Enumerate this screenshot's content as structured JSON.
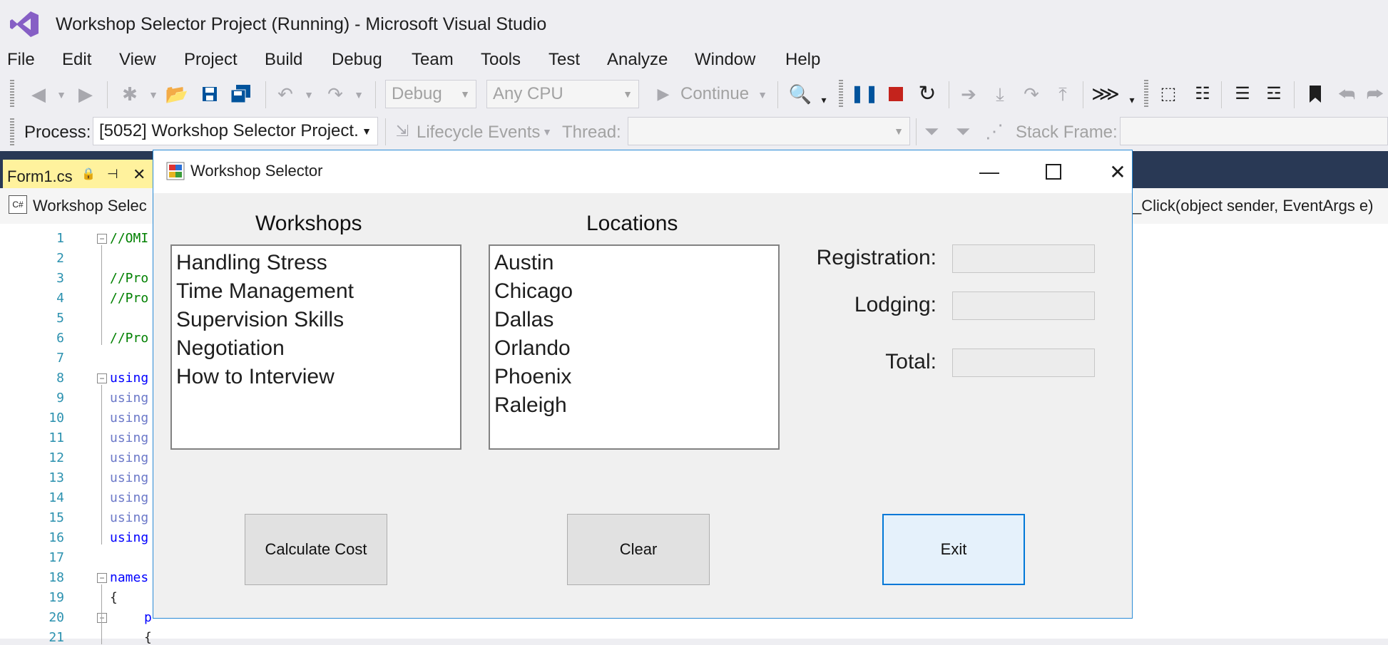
{
  "window": {
    "title": "Workshop Selector Project (Running) - Microsoft Visual Studio"
  },
  "menu": [
    "File",
    "Edit",
    "View",
    "Project",
    "Build",
    "Debug",
    "Team",
    "Tools",
    "Test",
    "Analyze",
    "Window",
    "Help"
  ],
  "toolbar": {
    "config": "Debug",
    "platform": "Any CPU",
    "continue_label": "Continue"
  },
  "debug_location": {
    "process_label": "Process:",
    "process_value": "[5052] Workshop Selector Project.",
    "lifecycle_label": "Lifecycle Events",
    "thread_label": "Thread:",
    "stack_frame_label": "Stack Frame:"
  },
  "editor": {
    "tab_label": "Form1.cs",
    "nav_left": "Workshop Selec",
    "nav_right": "_Click(object sender, EventArgs e)",
    "lines": [
      {
        "n": "1",
        "text": "//OMI",
        "cls": "cmt",
        "indent": 0
      },
      {
        "n": "2",
        "text": "",
        "cls": "",
        "indent": 0
      },
      {
        "n": "3",
        "text": "//Pro",
        "cls": "cmt",
        "indent": 0
      },
      {
        "n": "4",
        "text": "//Pro",
        "cls": "cmt",
        "indent": 0
      },
      {
        "n": "5",
        "text": "",
        "cls": "",
        "indent": 0
      },
      {
        "n": "6",
        "text": "//Pro",
        "cls": "cmt",
        "indent": 0
      },
      {
        "n": "7",
        "text": "",
        "cls": "",
        "indent": 0
      },
      {
        "n": "8",
        "text": "using",
        "cls": "kw",
        "indent": 0
      },
      {
        "n": "9",
        "text": "using",
        "cls": "kw-dim",
        "indent": 0
      },
      {
        "n": "10",
        "text": "using",
        "cls": "kw-dim",
        "indent": 0
      },
      {
        "n": "11",
        "text": "using",
        "cls": "kw-dim",
        "indent": 0
      },
      {
        "n": "12",
        "text": "using",
        "cls": "kw-dim",
        "indent": 0
      },
      {
        "n": "13",
        "text": "using",
        "cls": "kw-dim",
        "indent": 0
      },
      {
        "n": "14",
        "text": "using",
        "cls": "kw-dim",
        "indent": 0
      },
      {
        "n": "15",
        "text": "using",
        "cls": "kw-dim",
        "indent": 0
      },
      {
        "n": "16",
        "text": "using",
        "cls": "kw",
        "indent": 0
      },
      {
        "n": "17",
        "text": "",
        "cls": "",
        "indent": 0
      },
      {
        "n": "18",
        "text": "names",
        "cls": "kw",
        "indent": 0
      },
      {
        "n": "19",
        "text": "{",
        "cls": "",
        "indent": 0
      },
      {
        "n": "20",
        "text": "p",
        "cls": "kw",
        "indent": 1
      },
      {
        "n": "21",
        "text": "{",
        "cls": "",
        "indent": 1
      }
    ]
  },
  "form": {
    "title": "Workshop Selector",
    "workshops_heading": "Workshops",
    "locations_heading": "Locations",
    "workshops": [
      "Handling Stress",
      "Time Management",
      "Supervision Skills",
      "Negotiation",
      "How to Interview"
    ],
    "locations": [
      "Austin",
      "Chicago",
      "Dallas",
      "Orlando",
      "Phoenix",
      "Raleigh"
    ],
    "registration_label": "Registration:",
    "lodging_label": "Lodging:",
    "total_label": "Total:",
    "registration_value": "",
    "lodging_value": "",
    "total_value": "",
    "calculate_label": "Calculate Cost",
    "clear_label": "Clear",
    "exit_label": "Exit"
  }
}
